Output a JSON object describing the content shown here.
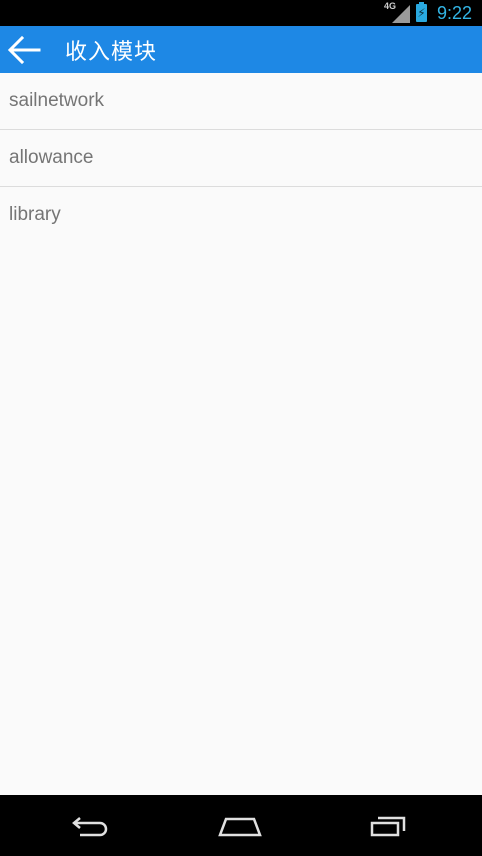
{
  "status_bar": {
    "network_type": "4G",
    "time": "9:22",
    "icons": [
      "signal-icon",
      "battery-charging-icon"
    ]
  },
  "app_bar": {
    "title": "收入模块",
    "back_icon": "back-arrow-icon",
    "background_color": "#1e88e5"
  },
  "list": {
    "items": [
      {
        "label": "sailnetwork"
      },
      {
        "label": "allowance"
      },
      {
        "label": "library"
      }
    ]
  },
  "nav_bar": {
    "buttons": [
      "back-icon",
      "home-icon",
      "recent-apps-icon"
    ]
  },
  "colors": {
    "accent": "#1e88e5",
    "status_time": "#33b5e5",
    "list_text": "#757575",
    "background": "#fafafa"
  }
}
